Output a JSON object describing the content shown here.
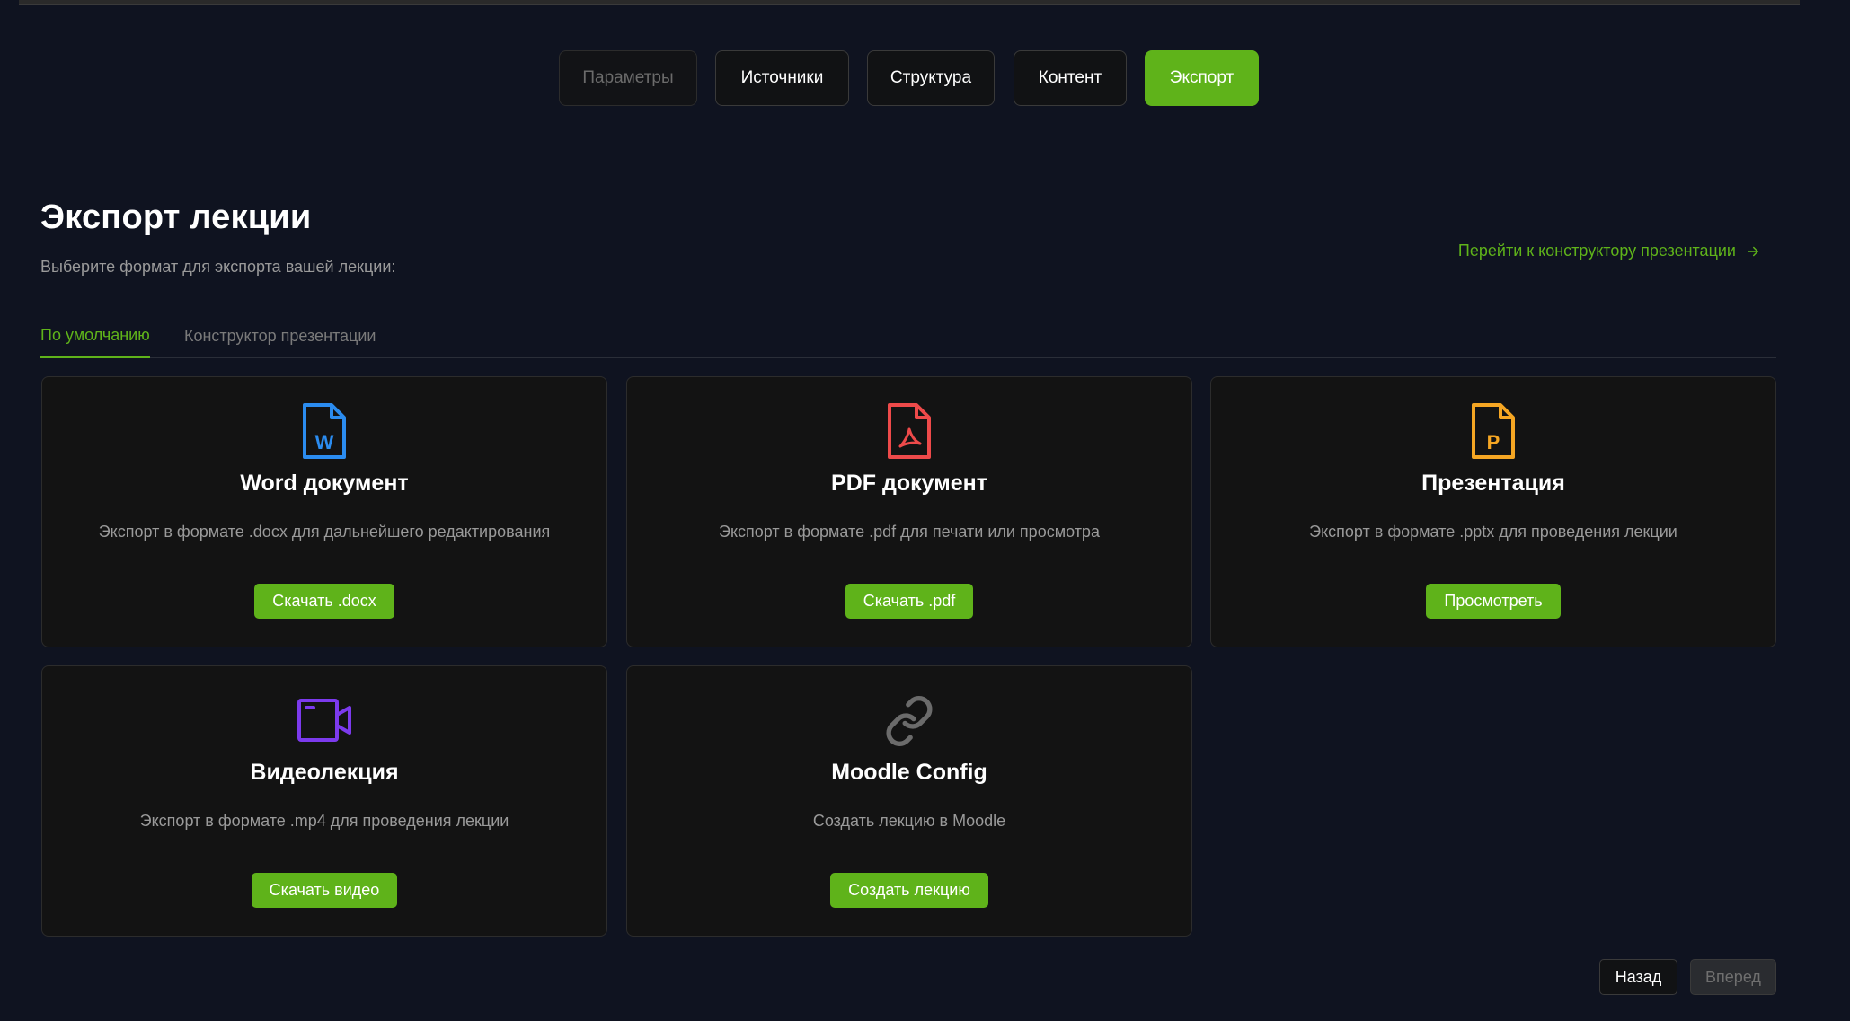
{
  "steps": [
    {
      "label": "Параметры",
      "state": "disabled"
    },
    {
      "label": "Источники",
      "state": "normal"
    },
    {
      "label": "Структура",
      "state": "normal"
    },
    {
      "label": "Контент",
      "state": "normal"
    },
    {
      "label": "Экспорт",
      "state": "active"
    }
  ],
  "page": {
    "title": "Экспорт лекции",
    "subtitle": "Выберите формат для экспорта вашей лекции:",
    "constructor_link": "Перейти к конструктору презентации"
  },
  "tabs": [
    {
      "label": "По умолчанию",
      "active": true
    },
    {
      "label": "Конструктор презентации",
      "active": false
    }
  ],
  "cards": [
    {
      "icon": "word-file-icon",
      "icon_color": "#2b8cf0",
      "title": "Word документ",
      "description": "Экспорт в формате .docx для дальнейшего редактирования",
      "button": "Скачать .docx"
    },
    {
      "icon": "pdf-file-icon",
      "icon_color": "#ee4a4a",
      "title": "PDF документ",
      "description": "Экспорт в формате .pdf для печати или просмотра",
      "button": "Скачать .pdf"
    },
    {
      "icon": "powerpoint-file-icon",
      "icon_color": "#f5a623",
      "title": "Презентация",
      "description": "Экспорт в формате .pptx для проведения лекции",
      "button": "Просмотреть"
    },
    {
      "icon": "video-camera-icon",
      "icon_color": "#7c3aed",
      "title": "Видеолекция",
      "description": "Экспорт в формате .mp4 для проведения лекции",
      "button": "Скачать видео"
    },
    {
      "icon": "link-icon",
      "icon_color": "#6b6b6b",
      "title": "Moodle Config",
      "description": "Создать лекцию в Moodle",
      "button": "Создать лекцию"
    }
  ],
  "navigation": {
    "back": "Назад",
    "next": "Вперед"
  },
  "colors": {
    "accent": "#5fb31a",
    "background": "#0f1320",
    "card": "#131313"
  }
}
